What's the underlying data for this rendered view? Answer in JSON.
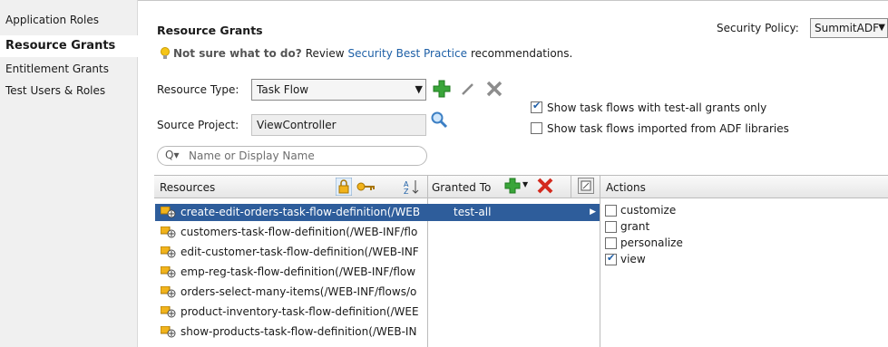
{
  "sidebar": {
    "items": [
      {
        "label": "Application Roles",
        "active": false
      },
      {
        "label": "Resource Grants",
        "active": true
      },
      {
        "label": "Entitlement Grants",
        "active": false
      },
      {
        "label": "Test Users & Roles",
        "active": false
      }
    ]
  },
  "header": {
    "title": "Resource Grants",
    "hint_bold": "Not sure what to do?",
    "hint_pre": "Review",
    "hint_link": "Security Best Practice",
    "hint_post": "recommendations.",
    "policy_label": "Security Policy:",
    "policy_value": "SummitADF"
  },
  "form": {
    "resource_type_label": "Resource Type:",
    "resource_type_value": "Task Flow",
    "source_project_label": "Source Project:",
    "source_project_value": "ViewController",
    "show_test_all_label": "Show task flows with test-all grants only",
    "show_test_all_checked": true,
    "show_imported_label": "Show task flows imported from ADF libraries",
    "show_imported_checked": false,
    "search_placeholder": "Name or Display Name"
  },
  "table": {
    "resources_header": "Resources",
    "granted_to_header": "Granted To",
    "actions_header": "Actions",
    "resources": [
      "create-edit-orders-task-flow-definition(/WEB",
      "customers-task-flow-definition(/WEB-INF/flo",
      "edit-customer-task-flow-definition(/WEB-INF",
      "emp-reg-task-flow-definition(/WEB-INF/flow",
      "orders-select-many-items(/WEB-INF/flows/o",
      "product-inventory-task-flow-definition(/WEE",
      "show-products-task-flow-definition(/WEB-IN"
    ],
    "selected_resource_index": 0,
    "granted_to": [
      "test-all"
    ],
    "actions": [
      {
        "label": "customize",
        "checked": false
      },
      {
        "label": "grant",
        "checked": false
      },
      {
        "label": "personalize",
        "checked": false
      },
      {
        "label": "view",
        "checked": true
      }
    ]
  },
  "colors": {
    "selection": "#2e5d9b",
    "link": "#1d5fa6",
    "add_green": "#3aa53a",
    "delete_red": "#d42a1e"
  }
}
